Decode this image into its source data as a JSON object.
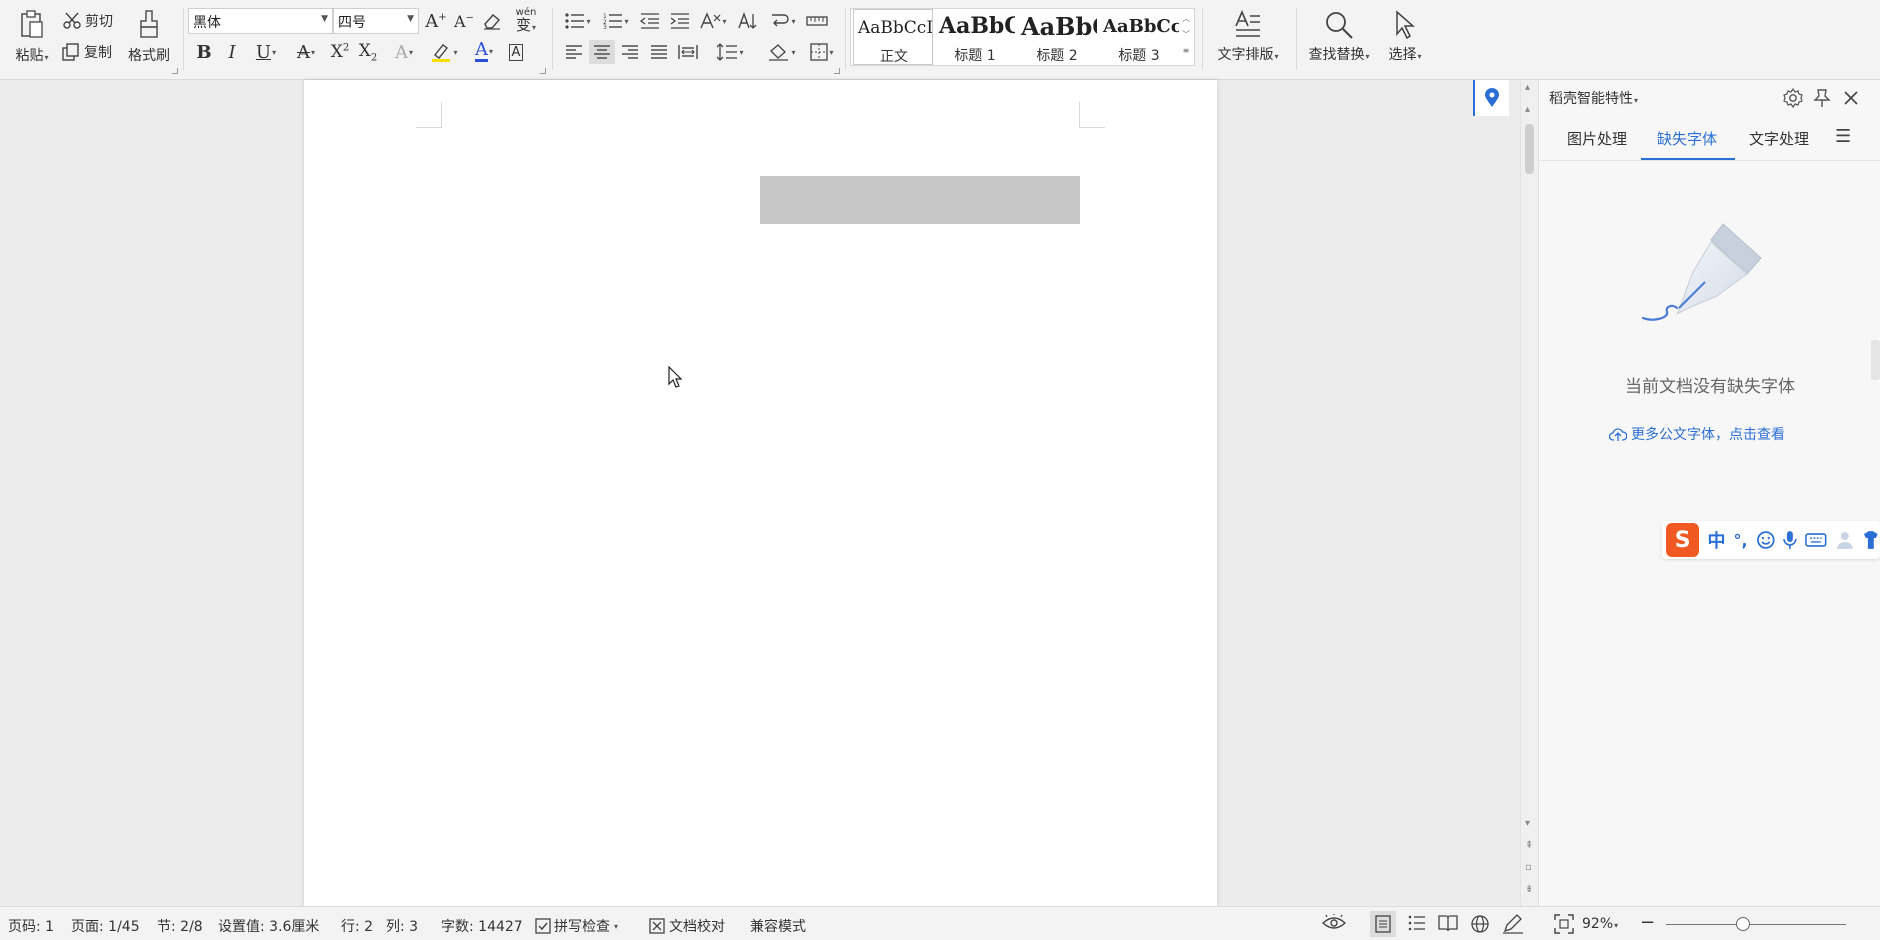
{
  "ribbon": {
    "clipboard": {
      "paste": "粘贴",
      "cut": "剪切",
      "copy": "复制",
      "format_painter": "格式刷"
    },
    "font": {
      "family": "黑体",
      "size": "四号"
    },
    "pinyin_glyph": "wén",
    "styles": [
      {
        "sample": "AaBbCcI",
        "name": "正文"
      },
      {
        "sample": "AaBbC",
        "name": "标题 1"
      },
      {
        "sample": "AaBbC",
        "name": "标题 2"
      },
      {
        "sample": "AaBbCcl",
        "name": "标题 3"
      }
    ],
    "text_layout": "文字排版",
    "find_replace": "查找替换",
    "select": "选择"
  },
  "panel": {
    "title": "稻壳智能特性",
    "tabs": [
      "图片处理",
      "缺失字体",
      "文字处理"
    ],
    "active_tab": 1,
    "empty_message": "当前文档没有缺失字体",
    "more_link": "更多公文字体，点击查看"
  },
  "ime": {
    "logo": "S",
    "mode": "中",
    "punct": "°,"
  },
  "status": {
    "page_code": "页码: 1",
    "page": "页面: 1/45",
    "section": "节: 2/8",
    "setting": "设置值: 3.6厘米",
    "row": "行: 2",
    "col": "列: 3",
    "word_count": "字数: 14427",
    "spell_check": "拼写检查",
    "doc_proof": "文档校对",
    "compat_mode": "兼容模式",
    "zoom": "92%"
  },
  "colors": {
    "accent": "#2b6fd6",
    "highlight": "#f5e000",
    "font_color": "#2b4fd6",
    "ime_logo": "#f05a22"
  }
}
